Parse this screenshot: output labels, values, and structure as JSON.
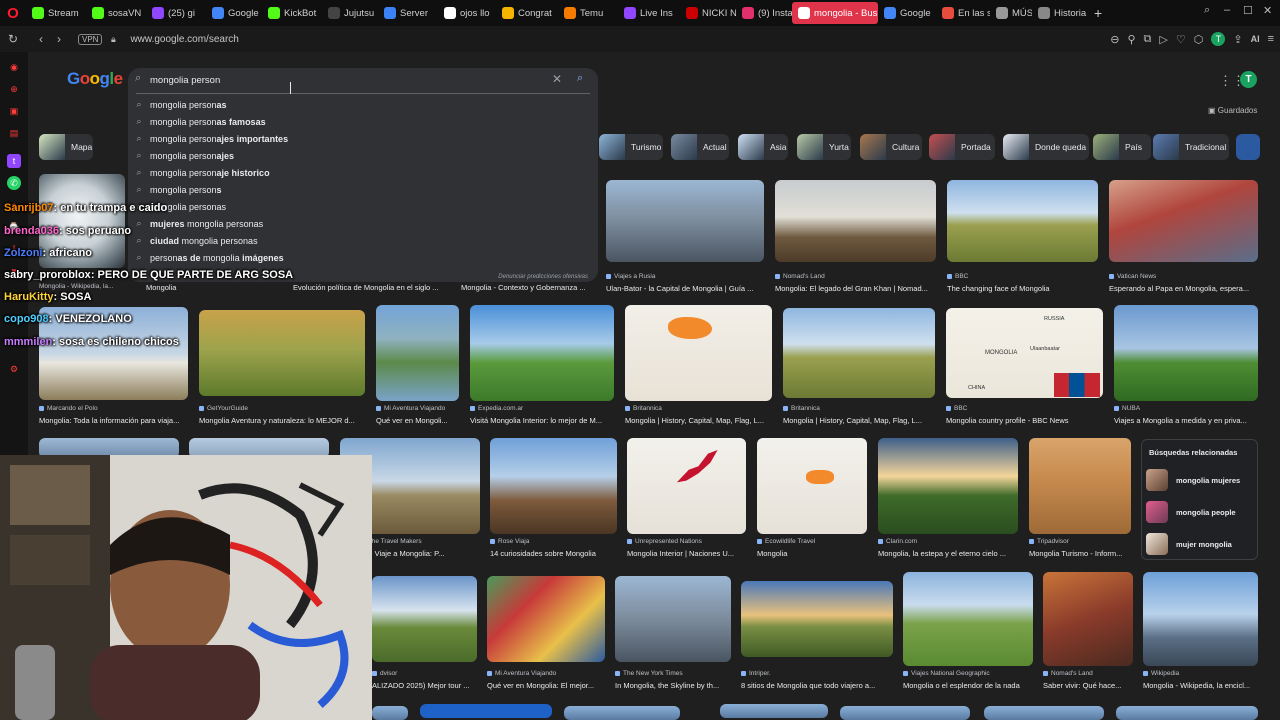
{
  "tabs": [
    {
      "label": "Stream",
      "icon": "kick-icon",
      "color": "#53fc18"
    },
    {
      "label": "sosaVN",
      "icon": "kick-icon",
      "color": "#53fc18"
    },
    {
      "label": "(25) gi",
      "icon": "twitch-icon",
      "color": "#9146ff"
    },
    {
      "label": "Google",
      "icon": "google-icon",
      "color": "#4285f4"
    },
    {
      "label": "KickBot",
      "icon": "kick-icon",
      "color": "#53fc18"
    },
    {
      "label": "Jujutsu",
      "icon": "ai-icon",
      "color": "#444"
    },
    {
      "label": "Server",
      "icon": "server-icon",
      "color": "#3b82f6"
    },
    {
      "label": "ojos llo",
      "icon": "google-icon",
      "color": "#ffffff"
    },
    {
      "label": "Congrat",
      "icon": "congrats-icon",
      "color": "#f4b400"
    },
    {
      "label": "Temu",
      "icon": "temu-icon",
      "color": "#f57c00"
    },
    {
      "label": "Live Ins",
      "icon": "twitch-icon",
      "color": "#9146ff"
    },
    {
      "label": "NICKI N",
      "icon": "music-icon",
      "color": "#c00"
    },
    {
      "label": "(9) Insta",
      "icon": "instagram-icon",
      "color": "#e1306c"
    },
    {
      "label": "mongolia - Bus",
      "icon": "google-icon",
      "color": "#ffffff",
      "active": true
    },
    {
      "label": "Google",
      "icon": "google-icon",
      "color": "#4285f4"
    },
    {
      "label": "En las s",
      "icon": "web-icon",
      "color": "#e74c3c"
    },
    {
      "label": "MÚS",
      "icon": "music-icon",
      "color": "#999"
    },
    {
      "label": "Historia",
      "icon": "history-icon",
      "color": "#888"
    }
  ],
  "address": {
    "vpn": "VPN",
    "url": "www.google.com/search"
  },
  "search": {
    "value": "mongolia person",
    "suggestions": [
      {
        "prefix": "mongolia person",
        "suffix": "as"
      },
      {
        "prefix": "mongolia person",
        "suffix": "as famosas"
      },
      {
        "prefix": "mongolia person",
        "suffix": "ajes importantes"
      },
      {
        "prefix": "mongolia person",
        "suffix": "ajes"
      },
      {
        "prefix": "mongolia person",
        "suffix": "aje historico"
      },
      {
        "prefix": "mongolia person",
        "suffix": "s"
      },
      {
        "prefix": "",
        "suffix": "",
        "plain": "mongolia personas"
      },
      {
        "prefix": "",
        "bold_first": "mujeres",
        "rest": " mongolia personas"
      },
      {
        "prefix": "",
        "bold_first": "ciudad",
        "rest": " mongolia personas"
      },
      {
        "prefix": "",
        "plain_pre": "person",
        "bold_mid": "as de",
        "plain_mid": " mongolia ",
        "bold_end": "imágenes"
      }
    ],
    "report": "Denunciar predicciones ofensivas"
  },
  "header": {
    "logo": "Google",
    "avatar": "T",
    "saved": "Guardados"
  },
  "chips": [
    "Mapa",
    "Turismo",
    "Actual",
    "Asia",
    "Yurta",
    "Cultura",
    "Portada",
    "Donde queda",
    "País",
    "Tradicional"
  ],
  "row1": [
    {
      "source": "Mongolia - Wikipedia, la...",
      "title": "Mongolia"
    },
    {
      "source": "",
      "title": "Evolución política de Mongolia en el siglo ..."
    },
    {
      "source": "",
      "title": "Mongolia - Contexto y Gobernanza ..."
    },
    {
      "source": "Viajes a Rusia",
      "title": "Ulan-Bator - la Capital de Mongolia | Guía ..."
    },
    {
      "source": "Nomad's Land",
      "title": "Mongolia: El legado del Gran Khan | Nomad..."
    },
    {
      "source": "BBC",
      "title": "The changing face of Mongolia"
    },
    {
      "source": "Vatican News",
      "title": "Esperando al Papa en Mongolia, espera..."
    }
  ],
  "row2": [
    {
      "source": "Marcando el Polo",
      "title": "Mongolia: Toda la información para viaja..."
    },
    {
      "source": "GetYourGuide",
      "title": "Mongolia Aventura y naturaleza: lo MEJOR d..."
    },
    {
      "source": "Mi Aventura Viajando",
      "title": "Qué ver en Mongoli..."
    },
    {
      "source": "Expedia.com.ar",
      "title": "Visitá Mongolia Interior: lo mejor de M..."
    },
    {
      "source": "Britannica",
      "title": "Mongolia | History, Capital, Map, Flag, L..."
    },
    {
      "source": "Britannica",
      "title": "Mongolia | History, Capital, Map, Flag, L..."
    },
    {
      "source": "BBC",
      "title": "Mongolia country profile - BBC News"
    },
    {
      "source": "NUBA",
      "title": "Viajes a Mongolia a medida y en priva..."
    }
  ],
  "map_labels": {
    "russia": "RUSSIA",
    "mongolia": "MONGOLIA",
    "ulaanbaatar": "Ulaanbaatar",
    "china": "CHINA"
  },
  "row3": [
    {
      "source": "apper, The Travel Makers",
      "title": "Mongolia: Viaje a Mongolia: P..."
    },
    {
      "source": "Rose Viaja",
      "title": "14 curiosidades sobre Mongolia"
    },
    {
      "source": "Unrepresented Nations",
      "title": "Mongolia Interior | Naciones U..."
    },
    {
      "source": "Ecowildlife Travel",
      "title": "Mongolia"
    },
    {
      "source": "Clarin.com",
      "title": "Mongolia, la estepa y el eterno cielo ..."
    },
    {
      "source": "Tripadvisor",
      "title": "Mongolia Turismo - Inform..."
    }
  ],
  "row4": [
    {
      "source": "dvisor",
      "title": "ALIZADO 2025) Mejor tour ..."
    },
    {
      "source": "Mi Aventura Viajando",
      "title": "Qué ver en Mongolia: El mejor..."
    },
    {
      "source": "The New York Times",
      "title": "In Mongolia, the Skyline by th..."
    },
    {
      "source": "Intriper.",
      "title": "8 sitios de Mongolia que todo viajero a..."
    },
    {
      "source": "Viajes National Geographic",
      "title": "Mongolia o el esplendor de la nada"
    },
    {
      "source": "Nomad's Land",
      "title": "Saber vivir: Qué hace..."
    },
    {
      "source": "Wikipedia",
      "title": "Mongolia - Wikipedia, la encicl..."
    }
  ],
  "related": {
    "heading": "Búsquedas relacionadas",
    "items": [
      "mongolia mujeres",
      "mongolia people",
      "mujer mongolia"
    ]
  },
  "chat": [
    {
      "user": "Sanrijb07",
      "msg": ": en tu trampa e caido",
      "color": "#ff8c00"
    },
    {
      "user": "brenda036",
      "msg": ": sos peruano",
      "color": "#ff66cc"
    },
    {
      "user": "Zolzoni",
      "msg": ": africano",
      "color": "#4d7cff"
    },
    {
      "user": "sabry_proroblox",
      "msg": ": PERO DE QUE PARTE DE ARG SOSA",
      "color": "#ffffff"
    },
    {
      "user": "HaruKitty",
      "msg": ": SOSA",
      "color": "#ffd43b"
    },
    {
      "user": "copo908",
      "msg": ": VENEZOLANO",
      "color": "#4dd0ff"
    },
    {
      "user": "mmmilen",
      "msg": ": sosa es chileno chicos",
      "color": "#c77dff"
    }
  ]
}
